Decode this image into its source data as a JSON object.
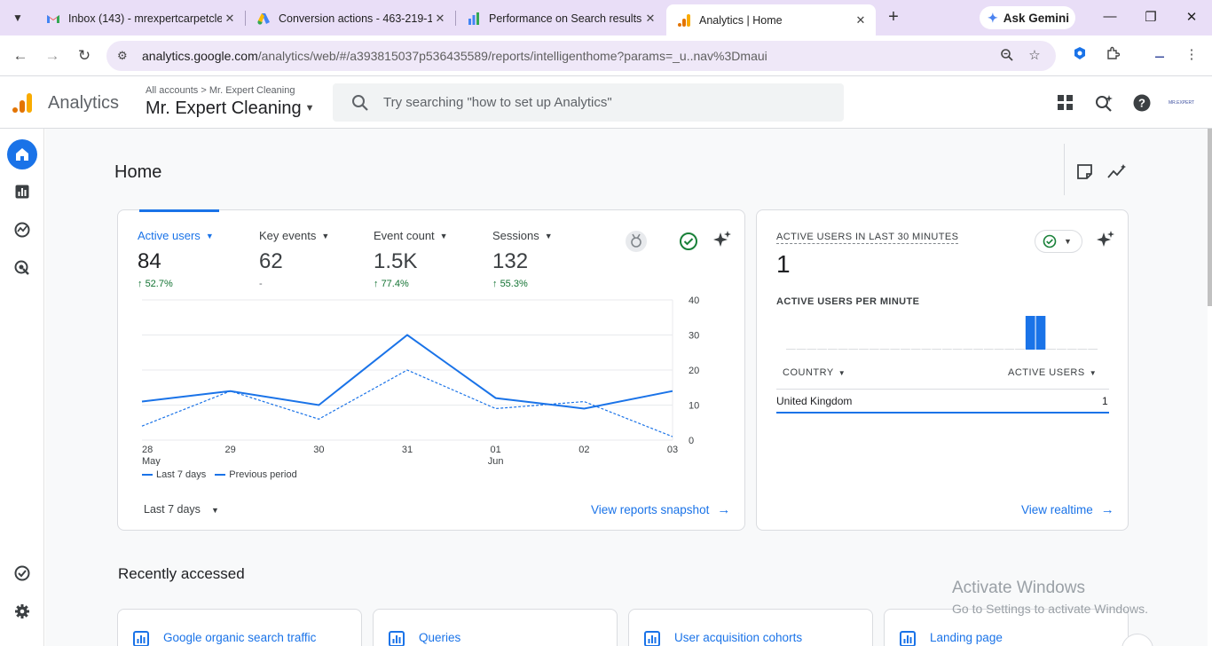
{
  "browser": {
    "tabs": [
      {
        "title": "Inbox (143) - mrexpertcarpetcle",
        "icon": "gmail-icon"
      },
      {
        "title": "Conversion actions - 463-219-1",
        "icon": "google-ads-icon"
      },
      {
        "title": "Performance on Search results",
        "icon": "search-console-icon"
      },
      {
        "title": "Analytics | Home",
        "icon": "analytics-icon",
        "active": true
      }
    ],
    "gemini_label": "Ask Gemini",
    "url_host": "analytics.google.com",
    "url_path": "/analytics/web/#/a393815037p536435589/reports/intelligenthome?params=_u..nav%3Dmaui"
  },
  "header": {
    "brand": "Analytics",
    "breadcrumb_root": "All accounts",
    "breadcrumb_sep": ">",
    "breadcrumb_account": "Mr. Expert Cleaning",
    "property": "Mr. Expert Cleaning",
    "search_placeholder": "Try searching \"how to set up Analytics\"",
    "avatar_text": "MR.EXPERT"
  },
  "page": {
    "title": "Home"
  },
  "overview": {
    "metrics": [
      {
        "label": "Active users",
        "value": "84",
        "change": "52.7%",
        "direction": "up",
        "selected": true
      },
      {
        "label": "Key events",
        "value": "62",
        "change": "-",
        "direction": "none"
      },
      {
        "label": "Event count",
        "value": "1.5K",
        "change": "77.4%",
        "direction": "up"
      },
      {
        "label": "Sessions",
        "value": "132",
        "change": "55.3%",
        "direction": "up"
      }
    ],
    "legend_current": "Last 7 days",
    "legend_previous": "Previous period",
    "date_range": "Last 7 days",
    "link": "View reports snapshot"
  },
  "chart_data": {
    "type": "line",
    "x": [
      "28 May",
      "29",
      "30",
      "31",
      "01 Jun",
      "02",
      "03"
    ],
    "x_ticks": [
      {
        "top": "28",
        "bottom": "May"
      },
      {
        "top": "29",
        "bottom": ""
      },
      {
        "top": "30",
        "bottom": ""
      },
      {
        "top": "31",
        "bottom": ""
      },
      {
        "top": "01",
        "bottom": "Jun"
      },
      {
        "top": "02",
        "bottom": ""
      },
      {
        "top": "03",
        "bottom": ""
      }
    ],
    "series": [
      {
        "name": "Last 7 days",
        "style": "solid",
        "values": [
          11,
          14,
          10,
          30,
          12,
          9,
          14
        ]
      },
      {
        "name": "Previous period",
        "style": "dashed",
        "values": [
          4,
          14,
          6,
          20,
          9,
          11,
          1
        ]
      }
    ],
    "ylim": [
      0,
      40
    ],
    "y_ticks": [
      0,
      10,
      20,
      30,
      40
    ],
    "y_axis_side": "right",
    "grid": true,
    "color": "#1a73e8"
  },
  "realtime": {
    "title": "ACTIVE USERS IN LAST 30 MINUTES",
    "value": "1",
    "per_minute_label": "ACTIVE USERS PER MINUTE",
    "per_minute_bars": [
      0,
      0,
      0,
      0,
      0,
      0,
      0,
      0,
      0,
      0,
      0,
      0,
      0,
      0,
      0,
      0,
      0,
      0,
      0,
      0,
      0,
      0,
      0,
      1,
      1,
      0,
      0,
      0,
      0,
      0
    ],
    "col_country": "COUNTRY",
    "col_users": "ACTIVE USERS",
    "rows": [
      {
        "country": "United Kingdom",
        "users": "1"
      }
    ],
    "link": "View realtime"
  },
  "recent": {
    "title": "Recently accessed",
    "items": [
      {
        "label": "Google organic search traffic"
      },
      {
        "label": "Queries"
      },
      {
        "label": "User acquisition cohorts"
      },
      {
        "label": "Landing page"
      }
    ]
  },
  "watermark": {
    "line1": "Activate Windows",
    "line2": "Go to Settings to activate Windows."
  },
  "colors": {
    "accent": "#1a73e8",
    "positive": "#137333",
    "tabbar": "#e9def7"
  }
}
